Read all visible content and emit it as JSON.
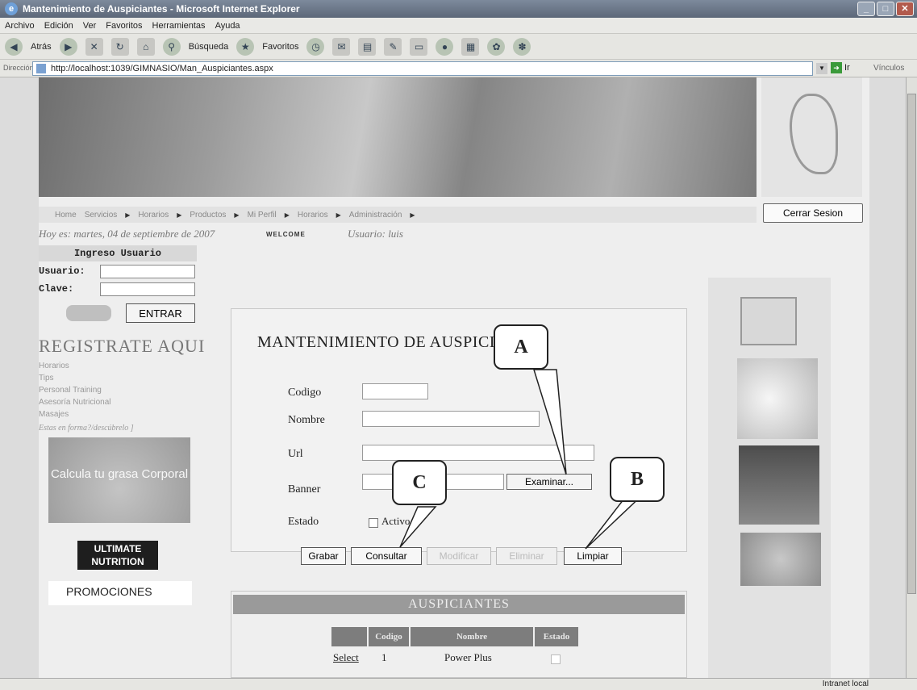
{
  "window": {
    "title": "Mantenimiento de Auspiciantes - Microsoft Internet Explorer"
  },
  "menu": [
    "Archivo",
    "Edición",
    "Ver",
    "Favoritos",
    "Herramientas",
    "Ayuda"
  ],
  "toolbar": {
    "back_label": "Atrás",
    "search_label": "Búsqueda",
    "favorites_label": "Favoritos"
  },
  "address": {
    "label": "Dirección",
    "url": "http://localhost:1039/GIMNASIO/Man_Auspiciantes.aspx",
    "go_label": "Ir",
    "links_label": "Vínculos"
  },
  "nav": [
    "Home",
    "Servicios",
    "Horarios",
    "Productos",
    "Mi Perfil",
    "Horarios",
    "Administración"
  ],
  "logout_label": "Cerrar Sesion",
  "date_line": "Hoy es: martes, 04 de septiembre de 2007",
  "welcome_label": "WELCOME",
  "user_line": "Usuario: luis",
  "login": {
    "title": "Ingreso Usuario",
    "user_label": "Usuario:",
    "password_label": "Clave:",
    "enter_button": "ENTRAR"
  },
  "register_label": "REGISTRATE AQUI",
  "left_links": [
    "Horarios",
    "Tips",
    "Personal Training",
    "Asesoría Nutricional",
    "Masajes"
  ],
  "left_note": "Estas en forma?/descúbrelo ]",
  "calc_label": "Calcula tu grasa Corporal",
  "ultimate_label": "ULTIMATE NUTRITION",
  "promo_label": "PROMOCIONES",
  "form": {
    "title": "MANTENIMIENTO DE AUSPICIANTES",
    "codigo_label": "Codigo",
    "nombre_label": "Nombre",
    "url_label": "Url",
    "banner_label": "Banner",
    "estado_label": "Estado",
    "examinar_label": "Examinar...",
    "activo_label": "Activo",
    "buttons": {
      "grabar": "Grabar",
      "consultar": "Consultar",
      "modificar": "Modificar",
      "eliminar": "Eliminar",
      "limpiar": "Limpiar"
    }
  },
  "callouts": {
    "a": "A",
    "b": "B",
    "c": "C"
  },
  "grid": {
    "title": "AUSPICIANTES",
    "headers": [
      "Codigo",
      "Nombre",
      "Estado"
    ],
    "rows": [
      {
        "select": "Select",
        "codigo": "1",
        "nombre": "Power Plus"
      }
    ]
  },
  "status": {
    "zone": "Intranet local"
  }
}
